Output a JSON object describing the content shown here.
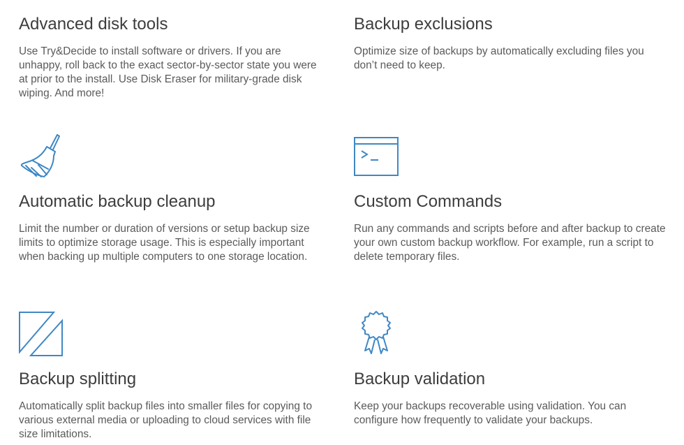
{
  "accent_color": "#3f88c5",
  "features": [
    {
      "icon": "",
      "title": "Advanced disk tools",
      "description": "Use Try&Decide to install software or drivers. If you are unhappy, roll back to the exact sector-by-sector state you were at prior to the install. Use Disk Eraser for military-grade disk wiping. And more!"
    },
    {
      "icon": "",
      "title": "Backup exclusions",
      "description": "Optimize size of backups by automatically excluding files you don’t need to keep."
    },
    {
      "icon": "broom-icon",
      "title": "Automatic backup cleanup",
      "description": "Limit the number or duration of versions or setup backup size limits to optimize storage usage. This is especially important when backing up multiple computers to one storage location."
    },
    {
      "icon": "terminal-icon",
      "title": "Custom Commands",
      "description": "Run any commands and scripts before and after backup to create your own custom backup workflow. For example, run a script to delete temporary files."
    },
    {
      "icon": "split-icon",
      "title": "Backup splitting",
      "description": "Automatically split backup files into smaller files for copying to various external media or uploading to cloud services with file size limitations."
    },
    {
      "icon": "award-ribbon-icon",
      "title": "Backup validation",
      "description": "Keep your backups recoverable using validation. You can configure how frequently to validate your backups."
    }
  ]
}
